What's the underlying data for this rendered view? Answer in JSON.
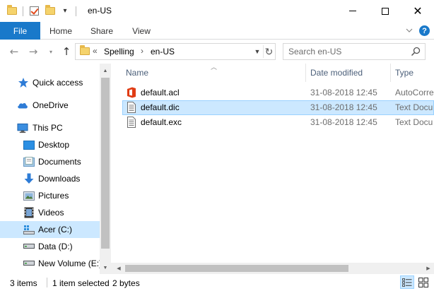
{
  "window": {
    "title": "en-US",
    "controls": {
      "minimize": "minimize-icon",
      "maximize": "maximize-icon",
      "close": "close-icon"
    }
  },
  "ribbon": {
    "tabs": [
      {
        "label": "File",
        "active": true
      },
      {
        "label": "Home"
      },
      {
        "label": "Share"
      },
      {
        "label": "View"
      }
    ],
    "expand_icon": "chevron-down-icon",
    "help_label": "?"
  },
  "address": {
    "prefix": "«",
    "crumbs": [
      "Spelling",
      "en-US"
    ],
    "separator": "›"
  },
  "search": {
    "placeholder": "Search en-US"
  },
  "nav": {
    "items": [
      {
        "label": "Quick access",
        "icon": "star-icon"
      },
      {
        "label": "OneDrive",
        "icon": "cloud-icon"
      },
      {
        "label": "This PC",
        "icon": "computer-icon"
      },
      {
        "label": "Desktop",
        "icon": "desktop-folder-icon"
      },
      {
        "label": "Documents",
        "icon": "documents-folder-icon"
      },
      {
        "label": "Downloads",
        "icon": "download-arrow-icon"
      },
      {
        "label": "Pictures",
        "icon": "pictures-folder-icon"
      },
      {
        "label": "Videos",
        "icon": "videos-folder-icon"
      },
      {
        "label": "Acer (C:)",
        "icon": "windows-drive-icon",
        "selected": true
      },
      {
        "label": "Data (D:)",
        "icon": "drive-icon"
      },
      {
        "label": "New Volume (E:)",
        "icon": "drive-icon"
      }
    ]
  },
  "columns": {
    "name": "Name",
    "date": "Date modified",
    "type": "Type"
  },
  "files": [
    {
      "name": "default.acl",
      "date": "31-08-2018 12:45",
      "type": "AutoCorre",
      "icon": "office-file-icon"
    },
    {
      "name": "default.dic",
      "date": "31-08-2018 12:45",
      "type": "Text Docu",
      "icon": "text-file-icon",
      "selected": true
    },
    {
      "name": "default.exc",
      "date": "31-08-2018 12:45",
      "type": "Text Docu",
      "icon": "text-file-icon"
    }
  ],
  "status": {
    "count": "3 items",
    "selection": "1 item selected",
    "size": "2 bytes"
  },
  "colors": {
    "accent": "#1979ca",
    "selection": "#cce8ff",
    "selection_border": "#99d1ff",
    "header_text": "#4c607a",
    "secondary_text": "#6d6d6d"
  }
}
